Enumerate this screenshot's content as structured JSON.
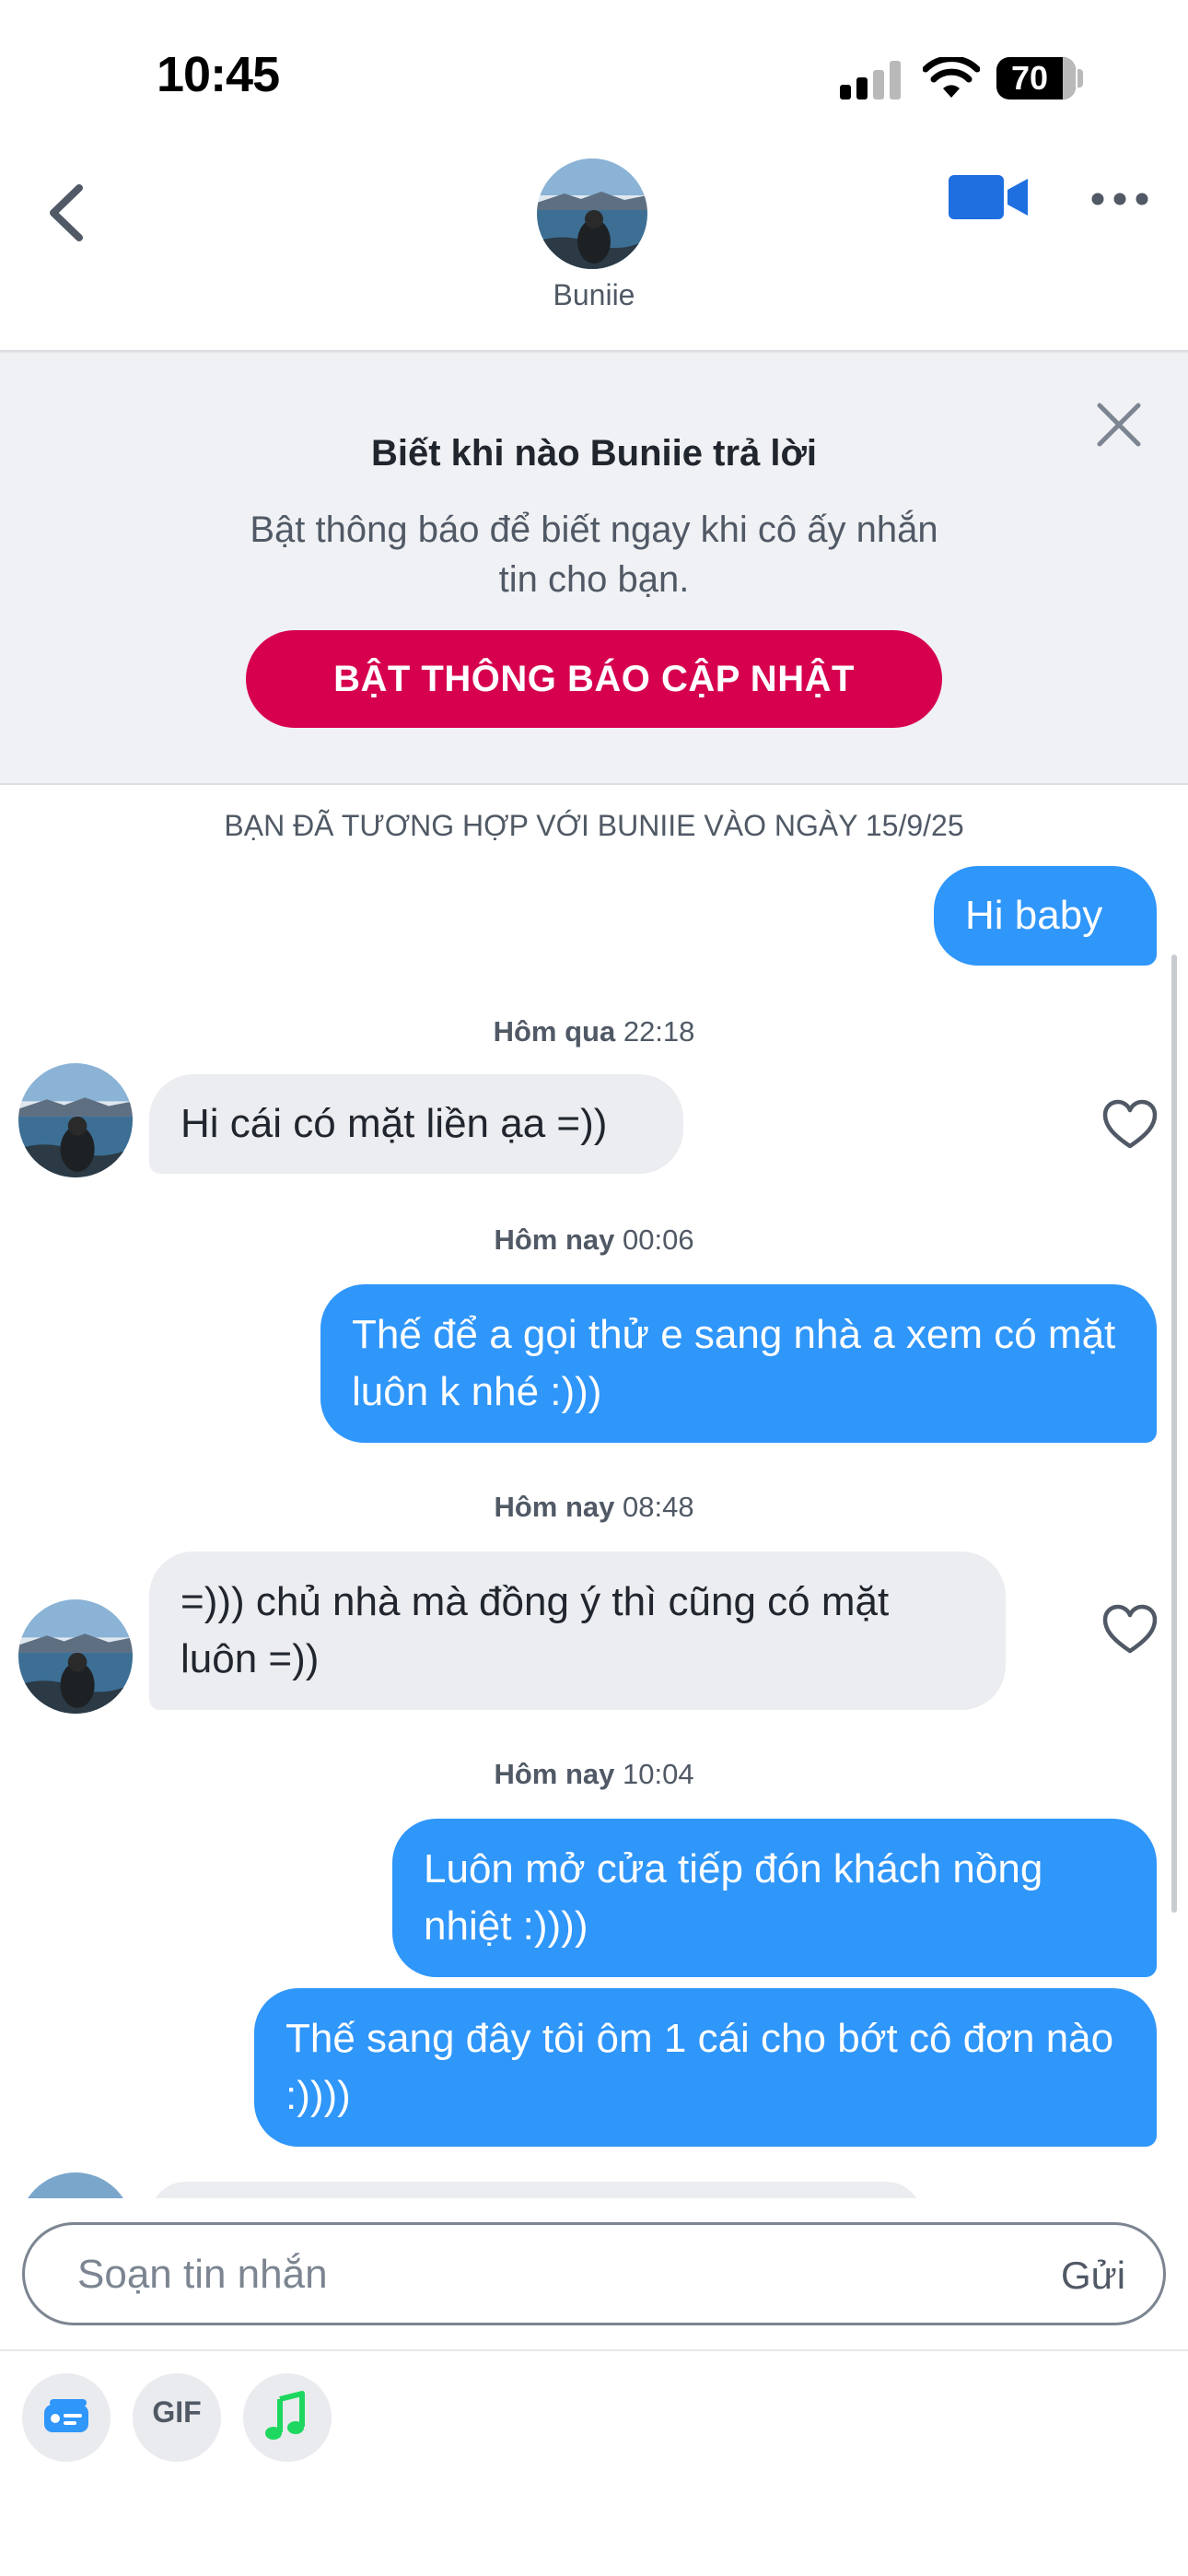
{
  "status_bar": {
    "time": "10:45",
    "battery": "70"
  },
  "header": {
    "name": "Buniie"
  },
  "banner": {
    "title": "Biết khi nào Buniie trả lời",
    "body": "Bật thông báo để biết ngay khi cô ấy nhắn tin cho bạn.",
    "cta": "BẬT THÔNG BÁO CẬP NHẬT"
  },
  "chat": {
    "match_notice": "BẠN ĐÃ TƯƠNG HỢP VỚI BUNIIE VÀO NGÀY 15/9/25",
    "timestamps": [
      {
        "day": "Hôm qua",
        "time": "22:18"
      },
      {
        "day": "Hôm nay",
        "time": "00:06"
      },
      {
        "day": "Hôm nay",
        "time": "08:48"
      },
      {
        "day": "Hôm nay",
        "time": "10:04"
      }
    ],
    "messages": [
      {
        "sender": "me",
        "text": "Hi baby"
      },
      {
        "sender": "them",
        "text": "Hi cái có mặt liền ạa =))"
      },
      {
        "sender": "me",
        "text": "Thế để a gọi thử e sang nhà a xem có mặt luôn k nhé :)))"
      },
      {
        "sender": "them",
        "text": "=))) chủ nhà mà đồng ý thì cũng có mặt luôn =))"
      },
      {
        "sender": "me",
        "text": "Luôn mở cửa tiếp đón khách nồng nhiệt :))))"
      },
      {
        "sender": "me",
        "text": "Thế sang đây tôi ôm 1 cái cho bớt cô đơn nào :))))"
      }
    ]
  },
  "composer": {
    "placeholder": "Soạn tin nhắn",
    "send_label": "Gửi",
    "tools": [
      {
        "icon": "sticker-card-icon",
        "color": "#2f96fa"
      },
      {
        "icon": "gif-icon",
        "label": "GIF"
      },
      {
        "icon": "music-note-icon",
        "color": "#1ed760"
      }
    ]
  },
  "colors": {
    "accent": "#d6004f",
    "outgoing_bubble": "#2f96fa",
    "incoming_bubble": "#ebedf0",
    "banner_bg": "#f0f1f4"
  }
}
